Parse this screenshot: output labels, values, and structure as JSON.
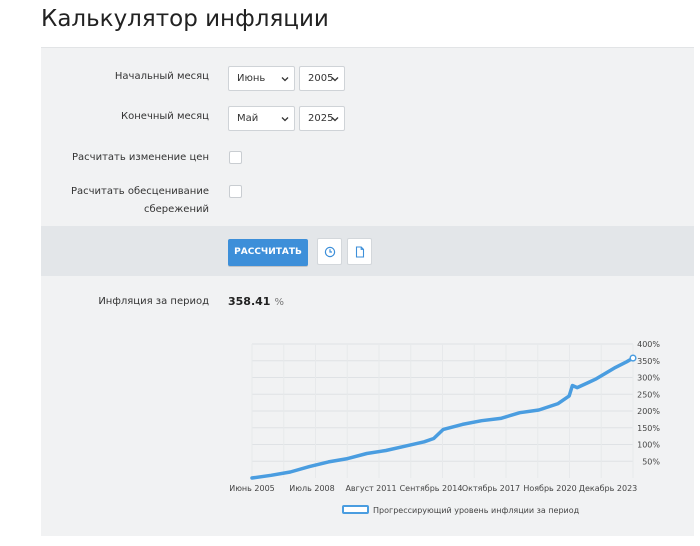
{
  "page": {
    "title": "Калькулятор инфляции"
  },
  "form": {
    "start_month": {
      "label": "Начальный месяц",
      "month": "Июнь",
      "year": "2005"
    },
    "end_month": {
      "label": "Конечный месяц",
      "month": "Май",
      "year": "2025"
    },
    "price_change": {
      "label": "Расчитать изменение цен",
      "checked": false
    },
    "savings_loss": {
      "label_line1": "Расчитать обесценивание",
      "label_line2": "сбережений",
      "checked": false
    }
  },
  "actions": {
    "calculate_label": "РАССЧИТАТЬ",
    "history_icon": "clock-icon",
    "document_icon": "document-icon"
  },
  "result": {
    "label": "Инфляция за период",
    "value": "358.41",
    "unit": "%"
  },
  "colors": {
    "accent": "#3d8fd9",
    "line": "#4a9de0",
    "panel": "#f1f2f3",
    "action_bar": "#e3e6e9"
  },
  "chart_data": {
    "type": "line",
    "title": "",
    "xlabel": "",
    "ylabel": "",
    "x_tick_labels": [
      "Июнь 2005",
      "Июль 2008",
      "Август 2011",
      "Сентябрь 2014",
      "Октябрь 2017",
      "Ноябрь 2020",
      "Декабрь 2023"
    ],
    "y_tick_labels": [
      "50%",
      "100%",
      "150%",
      "200%",
      "250%",
      "300%",
      "350%",
      "400%"
    ],
    "ylim": [
      0,
      400
    ],
    "legend_position": "bottom",
    "grid": true,
    "series": [
      {
        "name": "Прогрессирующий уровень инфляции за период",
        "x": [
          "2005-06",
          "2006-06",
          "2007-06",
          "2008-06",
          "2009-06",
          "2010-06",
          "2011-06",
          "2012-06",
          "2013-06",
          "2014-06",
          "2014-12",
          "2015-06",
          "2016-06",
          "2017-06",
          "2018-06",
          "2019-06",
          "2020-06",
          "2021-06",
          "2022-01",
          "2022-03",
          "2022-06",
          "2023-01",
          "2023-06",
          "2024-01",
          "2024-06",
          "2025-01",
          "2025-05"
        ],
        "values": [
          0,
          8,
          18,
          34,
          48,
          58,
          73,
          82,
          95,
          108,
          118,
          145,
          160,
          171,
          178,
          195,
          203,
          222,
          245,
          276,
          270,
          285,
          296,
          316,
          330,
          347,
          358
        ]
      }
    ]
  }
}
